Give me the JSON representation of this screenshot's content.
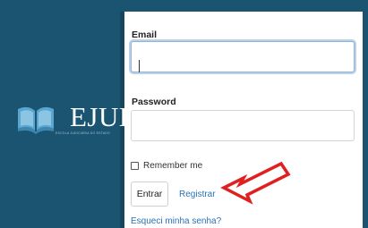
{
  "brand": {
    "name": "EJUD",
    "tagline": "ESCOLA JUDICIÁRIA DO ESTADO"
  },
  "login": {
    "email_label": "Email",
    "email_value": "",
    "password_label": "Password",
    "password_value": "",
    "remember_label": "Remember me",
    "remember_checked": false,
    "submit_label": "Entrar",
    "register_label": "Registrar",
    "forgot_label": "Esqueci minha senha?"
  },
  "colors": {
    "brand_panel": "#1b5470",
    "link": "#2b73b6",
    "annotation_arrow": "#e02020"
  },
  "icons": {
    "logo": "open-book-icon",
    "annotation": "red-arrow-pointer-icon"
  }
}
